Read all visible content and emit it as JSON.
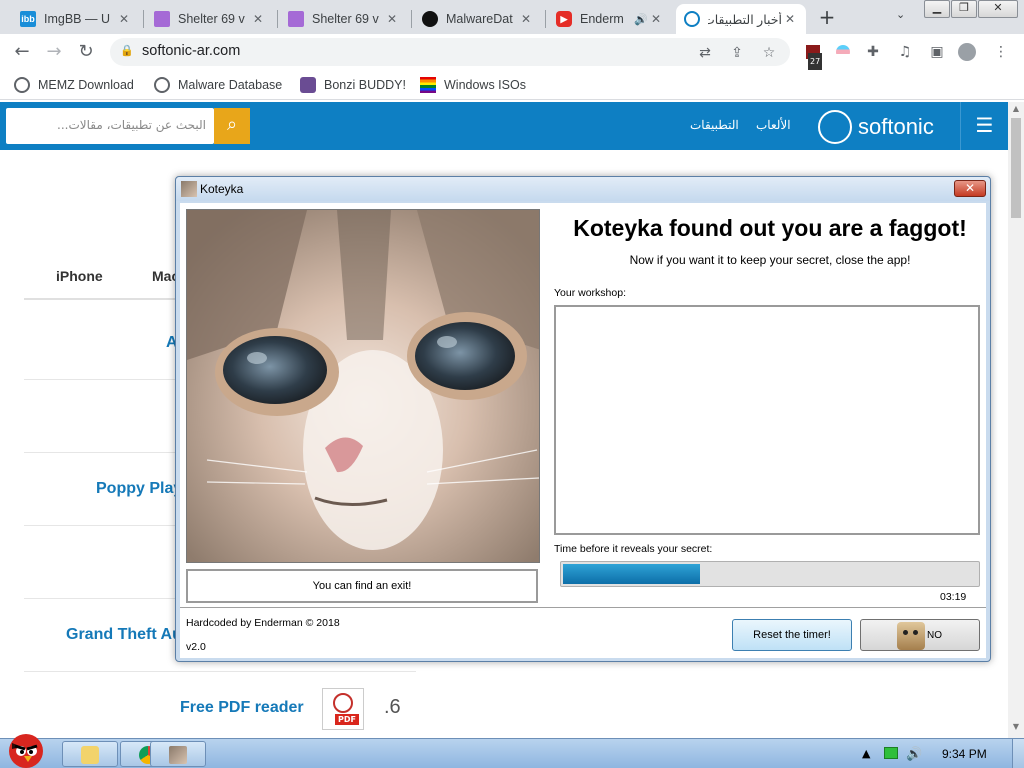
{
  "browser": {
    "tabs": [
      {
        "title": "ImgBB — U",
        "favicon": "imgbb-icon",
        "favicon_text": "ibb",
        "color": "#1a8ed8"
      },
      {
        "title": "Shelter 69 v",
        "favicon": "shelter-icon",
        "color": "#a56ad6"
      },
      {
        "title": "Shelter 69 v",
        "favicon": "shelter-icon",
        "color": "#a56ad6"
      },
      {
        "title": "MalwareDat",
        "favicon": "github-icon",
        "color": "#111111"
      },
      {
        "title": "Enderm",
        "favicon": "youtube-icon",
        "color": "#e52d27"
      },
      {
        "title": "أخبار التطبيقات",
        "favicon": "softonic-icon",
        "color": "#0e7fc3",
        "active": true
      }
    ],
    "url": "softonic-ar.com",
    "extension_badge": "27",
    "bookmarks": [
      {
        "label": "MEMZ Download"
      },
      {
        "label": "Malware Database"
      },
      {
        "label": "Bonzi BUDDY!"
      },
      {
        "label": "Windows ISOs"
      }
    ]
  },
  "site": {
    "search_placeholder": "البحث عن تطبيقات، مقالات...",
    "nav": [
      "الألعاب",
      "التطبيقات"
    ],
    "logo": "softonic",
    "page_tabs": [
      "iPhone",
      "Mac"
    ],
    "rows": [
      {
        "text": "A"
      },
      {
        "text": "Poppy Play"
      },
      {
        "text": "Grand Theft Au"
      },
      {
        "text": "Free PDF reader",
        "number": ".6",
        "icon_label": "PDF"
      }
    ]
  },
  "koteyka": {
    "window_title": "Koteyka",
    "close_label": "✕",
    "headline": "Koteyka found out you are a faggot!",
    "subtitle": "Now if you want it to keep your secret, close the app!",
    "workshop_label": "Your workshop:",
    "exit_text": "You can find an exit!",
    "timer_label": "Time before it reveals your secret:",
    "progress_fraction": 0.33,
    "time_remaining": "03:19",
    "credit": "Hardcoded by Enderman © 2018",
    "version": "v2.0",
    "reset_button": "Reset the timer!",
    "no_button": "NO"
  },
  "taskbar": {
    "clock": "9:34 PM",
    "items": [
      "folder-icon",
      "chrome-icon",
      "koteyka-icon"
    ]
  }
}
